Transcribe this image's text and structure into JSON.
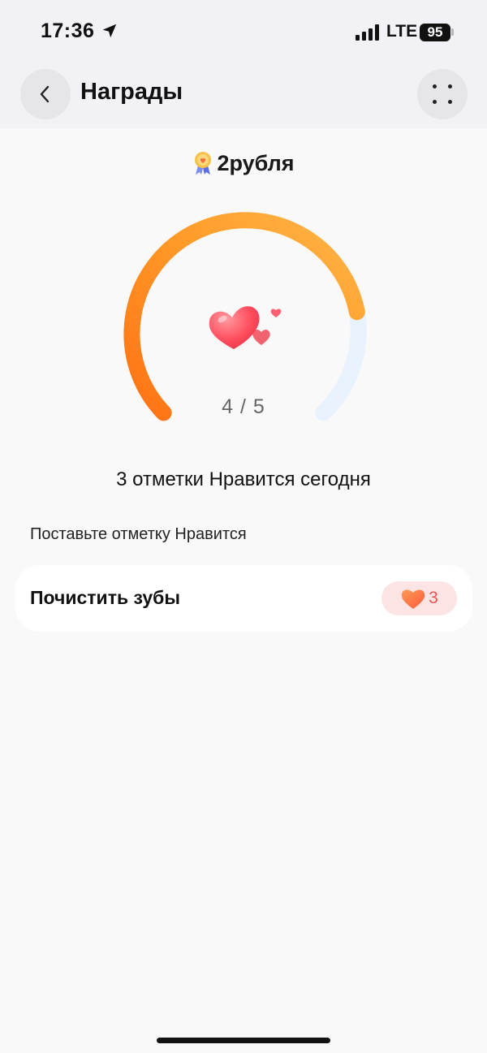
{
  "status_bar": {
    "time": "17:36",
    "network": "LTE",
    "battery": "95",
    "icons": [
      "location-arrow-icon",
      "signal-bars-icon",
      "battery-icon"
    ]
  },
  "header": {
    "title": "Награды",
    "back_icon": "chevron-left-icon",
    "menu_icon": "four-dots-icon"
  },
  "reward": {
    "icon": "medal-icon",
    "label": "2рубля"
  },
  "progress": {
    "current": 4,
    "total": 5,
    "text": "4 / 5",
    "center_icon": "hearts-icon",
    "colors": {
      "start": "#ff7a1a",
      "end": "#ffb03a",
      "track": "#e8f2fd"
    }
  },
  "likes_today": "3 отметки Нравится сегодня",
  "section_label": "Поставьте отметку Нравится",
  "tasks": [
    {
      "title": "Почистить зубы",
      "likes": "3",
      "like_icon": "heart-icon"
    }
  ],
  "colors": {
    "header_bg": "#f2f2f6",
    "page_bg": "#f9f9f9",
    "accent_orange": "#ff8c1a",
    "like_chip_bg": "#fde4e4",
    "like_red": "#e25555"
  }
}
